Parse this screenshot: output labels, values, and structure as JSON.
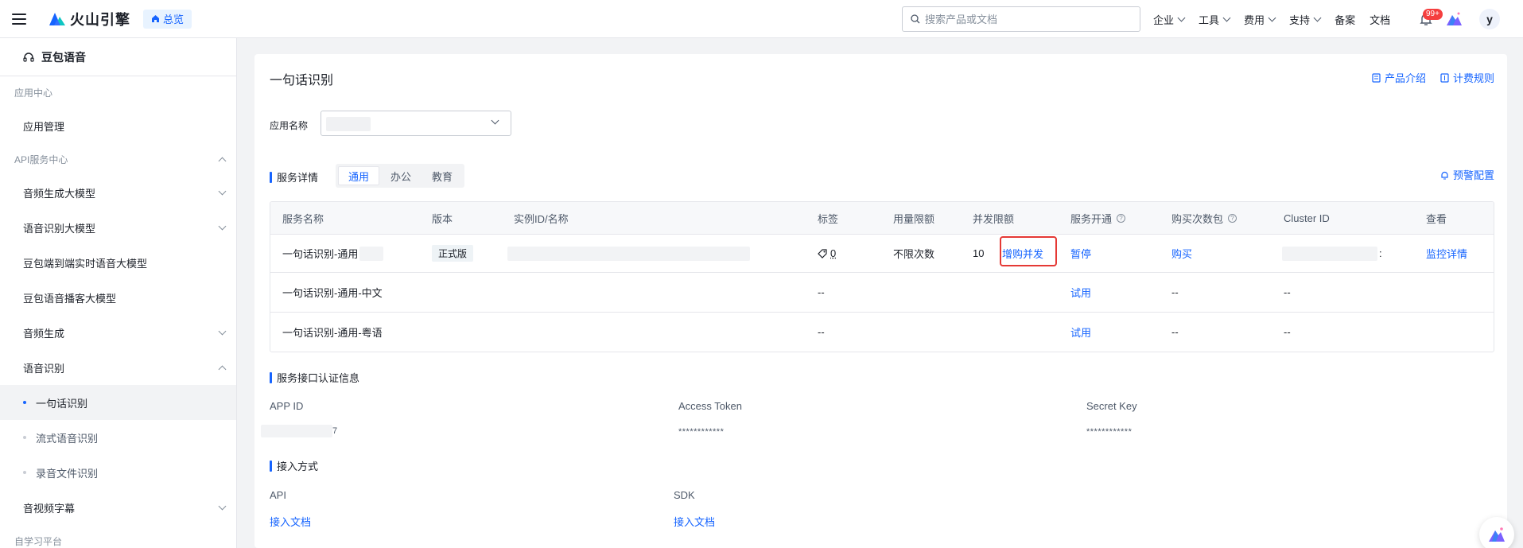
{
  "topbar": {
    "logo_text": "火山引擎",
    "overview_label": "总览",
    "search_placeholder": "搜索产品或文档",
    "nav": [
      "企业",
      "工具",
      "费用",
      "支持"
    ],
    "nav_plain": [
      "备案",
      "文档"
    ],
    "badge": "99+",
    "avatar": "y"
  },
  "sidebar": {
    "product": "豆包语音",
    "group_app": "应用中心",
    "app_manage": "应用管理",
    "group_api": "API服务中心",
    "items": [
      {
        "label": "音频生成大模型",
        "chev": "down"
      },
      {
        "label": "语音识别大模型",
        "chev": "down"
      },
      {
        "label": "豆包端到端实时语音大模型",
        "chev": ""
      },
      {
        "label": "豆包语音播客大模型",
        "chev": ""
      },
      {
        "label": "音频生成",
        "chev": "down"
      },
      {
        "label": "语音识别",
        "chev": "up"
      }
    ],
    "sub_items": [
      "一句话识别",
      "流式语音识别",
      "录音文件识别"
    ],
    "video_subtitle": "音视频字幕",
    "group_self": "自学习平台"
  },
  "main": {
    "title": "一句话识别",
    "product_intro": "产品介绍",
    "billing_rules": "计费规则",
    "app_name_label": "应用名称",
    "service_details": "服务详情",
    "tabs": [
      "通用",
      "办公",
      "教育"
    ],
    "alert_config": "预警配置",
    "table": {
      "headers": [
        "服务名称",
        "版本",
        "实例ID/名称",
        "标签",
        "用量限额",
        "并发限额",
        "服务开通",
        "购买次数包",
        "Cluster ID",
        "查看"
      ],
      "row1": {
        "name": "一句话识别-通用",
        "version": "正式版",
        "tag_count": "0",
        "usage": "不限次数",
        "concurrency": "10",
        "buy_concurrency": "增购并发",
        "service": "暂停",
        "buy": "购买",
        "cluster_suffix": ":",
        "view": "监控详情"
      },
      "row2": {
        "name": "一句话识别-通用-中文",
        "tag": "--",
        "service": "试用",
        "buy": "--",
        "cluster": "--"
      },
      "row3": {
        "name": "一句话识别-通用-粤语",
        "tag": "--",
        "service": "试用",
        "buy": "--",
        "cluster": "--"
      }
    },
    "auth_title": "服务接口认证信息",
    "app_id_label": "APP ID",
    "app_id_suffix": "7",
    "access_token_label": "Access Token",
    "access_token": "************",
    "secret_key_label": "Secret Key",
    "secret_key": "************",
    "access_title": "接入方式",
    "api_label": "API",
    "api_doc": "接入文档",
    "sdk_label": "SDK",
    "sdk_doc": "接入文档"
  },
  "colors": {
    "accent": "#1664ff",
    "highlight": "#e53935"
  }
}
